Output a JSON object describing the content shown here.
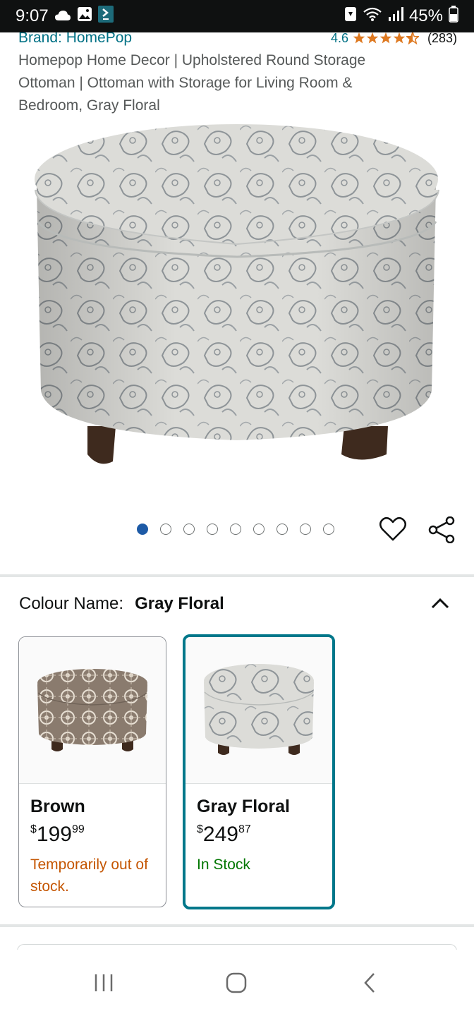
{
  "status": {
    "time": "9:07",
    "battery": "45%"
  },
  "product": {
    "brand": "Brand: HomePop",
    "rating": "4.6",
    "review_count": "(283)",
    "title": "Homepop Home Decor | Upholstered Round Storage Ottoman | Ottoman with Storage for Living Room & Bedroom, Gray Floral",
    "image_count": 9,
    "active_image_index": 0
  },
  "colour": {
    "label": "Colour Name:",
    "selected": "Gray Floral"
  },
  "variants": [
    {
      "name": "Brown",
      "currency": "$",
      "price_whole": "199",
      "price_fraction": "99",
      "stock": "Temporarily out of stock."
    },
    {
      "name": "Gray Floral",
      "currency": "$",
      "price_whole": "249",
      "price_fraction": "87",
      "stock": "In Stock"
    }
  ],
  "colors": {
    "link": "#007185",
    "star": "#ff9900",
    "selected_border": "#00778a",
    "out_of_stock": "#c45500",
    "in_stock": "#007600"
  }
}
